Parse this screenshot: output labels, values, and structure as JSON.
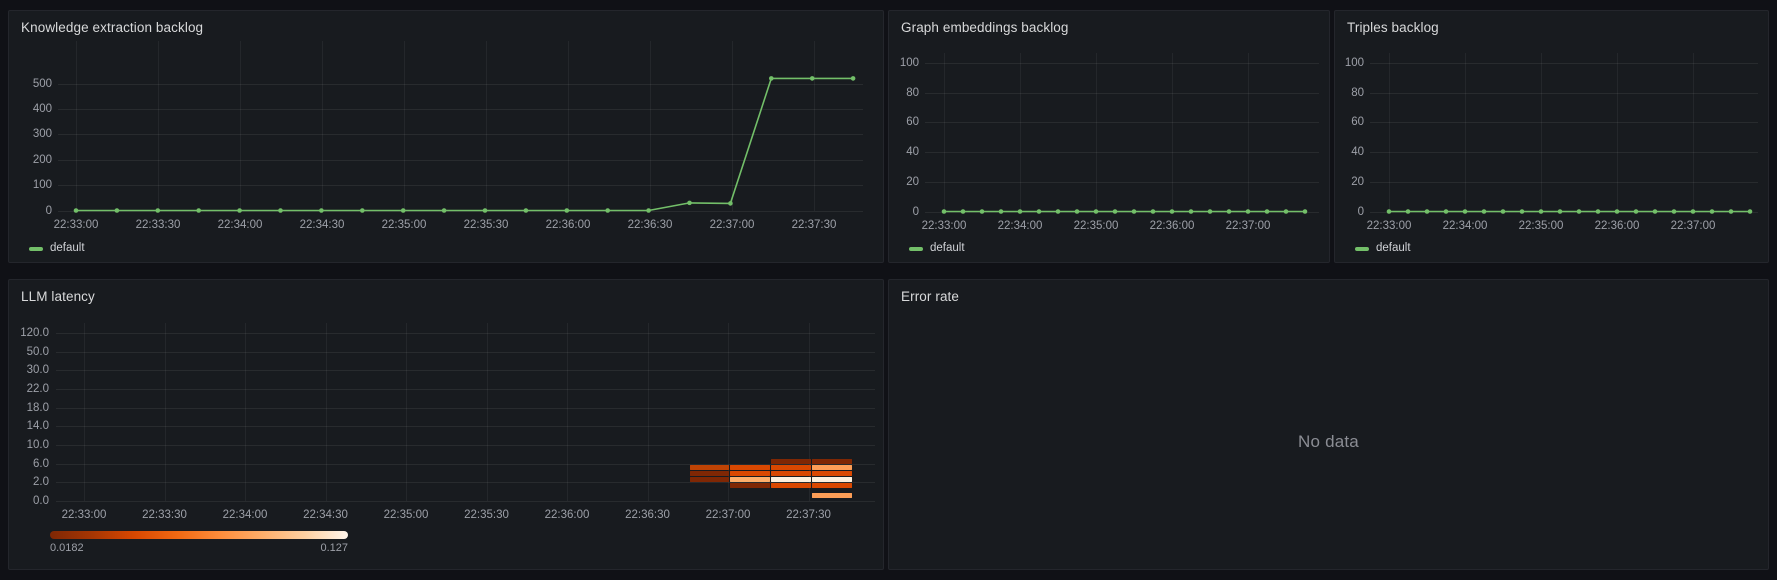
{
  "theme": {
    "page_bg": "#101116",
    "panel_bg": "#181b1f",
    "series_color": "#73bf69",
    "title_color": "#d8d9da",
    "tick_color": "#9da0a8"
  },
  "times_15s": [
    "22:33:00",
    "22:33:15",
    "22:33:30",
    "22:33:45",
    "22:34:00",
    "22:34:15",
    "22:34:30",
    "22:34:45",
    "22:35:00",
    "22:35:15",
    "22:35:30",
    "22:35:45",
    "22:36:00",
    "22:36:15",
    "22:36:30",
    "22:36:45",
    "22:37:00",
    "22:37:15",
    "22:37:30",
    "22:37:45"
  ],
  "panels": {
    "knowledge": {
      "title": "Knowledge extraction backlog",
      "legend": "default",
      "y_ticks": [
        "500",
        "400",
        "300",
        "200",
        "100",
        "0"
      ],
      "x_ticks": [
        "22:33:00",
        "22:33:30",
        "22:34:00",
        "22:34:30",
        "22:35:00",
        "22:35:30",
        "22:36:00",
        "22:36:30",
        "22:37:00",
        "22:37:30"
      ],
      "values": [
        0,
        0,
        0,
        0,
        0,
        0,
        0,
        0,
        0,
        0,
        0,
        0,
        0,
        0,
        0,
        30,
        28,
        520,
        520,
        520
      ]
    },
    "embeddings": {
      "title": "Graph embeddings backlog",
      "legend": "default",
      "y_ticks": [
        "100",
        "80",
        "60",
        "40",
        "20",
        "0"
      ],
      "x_ticks": [
        "22:33:00",
        "22:34:00",
        "22:35:00",
        "22:36:00",
        "22:37:00"
      ],
      "values": [
        0,
        0,
        0,
        0,
        0,
        0,
        0,
        0,
        0,
        0,
        0,
        0,
        0,
        0,
        0,
        0,
        0,
        0,
        0,
        0
      ]
    },
    "triples": {
      "title": "Triples backlog",
      "legend": "default",
      "y_ticks": [
        "100",
        "80",
        "60",
        "40",
        "20",
        "0"
      ],
      "x_ticks": [
        "22:33:00",
        "22:34:00",
        "22:35:00",
        "22:36:00",
        "22:37:00"
      ],
      "values": [
        0,
        0,
        0,
        0,
        0,
        0,
        0,
        0,
        0,
        0,
        0,
        0,
        0,
        0,
        0,
        0,
        0,
        0,
        0,
        0
      ]
    },
    "latency": {
      "title": "LLM latency",
      "y_ticks": [
        "120.0",
        "50.0",
        "30.0",
        "22.0",
        "18.0",
        "14.0",
        "10.0",
        "6.0",
        "2.0",
        "0.0"
      ],
      "x_ticks": [
        "22:33:00",
        "22:33:30",
        "22:34:00",
        "22:34:30",
        "22:35:00",
        "22:35:30",
        "22:36:00",
        "22:36:30",
        "22:37:00",
        "22:37:30"
      ],
      "colorbar": {
        "min_label": "0.0182",
        "max_label": "0.127",
        "colors": [
          "#7f2704",
          "#a63603",
          "#d94801",
          "#f16913",
          "#fd8d3c",
          "#fdae6b",
          "#fdd0a2",
          "#fff5eb"
        ]
      },
      "cells": [
        {
          "i": 15,
          "dy": 185,
          "color": "#bf4304",
          "time": "22:36:45"
        },
        {
          "i": 15,
          "dy": 191,
          "color": "#7f2704",
          "time": "22:36:45"
        },
        {
          "i": 15,
          "dy": 197,
          "color": "#7f2704",
          "time": "22:36:45"
        },
        {
          "i": 16,
          "dy": 185,
          "color": "#d94801",
          "time": "22:37:00"
        },
        {
          "i": 16,
          "dy": 191,
          "color": "#d94801",
          "time": "22:37:00"
        },
        {
          "i": 16,
          "dy": 197,
          "color": "#fdae6b",
          "time": "22:37:00"
        },
        {
          "i": 16,
          "dy": 203,
          "color": "#7f2704",
          "time": "22:37:00"
        },
        {
          "i": 17,
          "dy": 179,
          "color": "#7f2704",
          "time": "22:37:15"
        },
        {
          "i": 17,
          "dy": 185,
          "color": "#d94801",
          "time": "22:37:15"
        },
        {
          "i": 17,
          "dy": 191,
          "color": "#d94801",
          "time": "22:37:15"
        },
        {
          "i": 17,
          "dy": 197,
          "color": "#fdf0dd",
          "time": "22:37:15"
        },
        {
          "i": 17,
          "dy": 203,
          "color": "#d94801",
          "time": "22:37:15"
        },
        {
          "i": 18,
          "dy": 179,
          "color": "#7f2704",
          "time": "22:37:30"
        },
        {
          "i": 18,
          "dy": 185,
          "color": "#fd9e57",
          "time": "22:37:30"
        },
        {
          "i": 18,
          "dy": 191,
          "color": "#d94801",
          "time": "22:37:30"
        },
        {
          "i": 18,
          "dy": 197,
          "color": "#fdf0dd",
          "time": "22:37:30"
        },
        {
          "i": 18,
          "dy": 203,
          "color": "#d94801",
          "time": "22:37:30"
        },
        {
          "i": 18,
          "dy": 213,
          "color": "#fd9e57",
          "time": "22:37:30"
        }
      ]
    },
    "errorrate": {
      "title": "Error rate",
      "message": "No data"
    }
  },
  "chart_data": [
    {
      "type": "line",
      "title": "Knowledge extraction backlog",
      "legend": [
        "default"
      ],
      "x": [
        "22:33:00",
        "22:33:15",
        "22:33:30",
        "22:33:45",
        "22:34:00",
        "22:34:15",
        "22:34:30",
        "22:34:45",
        "22:35:00",
        "22:35:15",
        "22:35:30",
        "22:35:45",
        "22:36:00",
        "22:36:15",
        "22:36:30",
        "22:36:45",
        "22:37:00",
        "22:37:15",
        "22:37:30",
        "22:37:45"
      ],
      "series": [
        {
          "name": "default",
          "values": [
            0,
            0,
            0,
            0,
            0,
            0,
            0,
            0,
            0,
            0,
            0,
            0,
            0,
            0,
            0,
            30,
            28,
            520,
            520,
            520
          ]
        }
      ],
      "ylim": [
        0,
        560
      ],
      "grid": true,
      "line_color": "#73bf69",
      "legend_position": "bottom-left"
    },
    {
      "type": "line",
      "title": "Graph embeddings backlog",
      "legend": [
        "default"
      ],
      "x": [
        "22:33:00",
        "22:33:15",
        "22:33:30",
        "22:33:45",
        "22:34:00",
        "22:34:15",
        "22:34:30",
        "22:34:45",
        "22:35:00",
        "22:35:15",
        "22:35:30",
        "22:35:45",
        "22:36:00",
        "22:36:15",
        "22:36:30",
        "22:36:45",
        "22:37:00",
        "22:37:15",
        "22:37:30",
        "22:37:45"
      ],
      "series": [
        {
          "name": "default",
          "values": [
            0,
            0,
            0,
            0,
            0,
            0,
            0,
            0,
            0,
            0,
            0,
            0,
            0,
            0,
            0,
            0,
            0,
            0,
            0,
            0
          ]
        }
      ],
      "ylim": [
        0,
        100
      ],
      "grid": true,
      "line_color": "#73bf69",
      "legend_position": "bottom-left"
    },
    {
      "type": "line",
      "title": "Triples backlog",
      "legend": [
        "default"
      ],
      "x": [
        "22:33:00",
        "22:33:15",
        "22:33:30",
        "22:33:45",
        "22:34:00",
        "22:34:15",
        "22:34:30",
        "22:34:45",
        "22:35:00",
        "22:35:15",
        "22:35:30",
        "22:35:45",
        "22:36:00",
        "22:36:15",
        "22:36:30",
        "22:36:45",
        "22:37:00",
        "22:37:15",
        "22:37:30",
        "22:37:45"
      ],
      "series": [
        {
          "name": "default",
          "values": [
            0,
            0,
            0,
            0,
            0,
            0,
            0,
            0,
            0,
            0,
            0,
            0,
            0,
            0,
            0,
            0,
            0,
            0,
            0,
            0
          ]
        }
      ],
      "ylim": [
        0,
        100
      ],
      "grid": true,
      "line_color": "#73bf69",
      "legend_position": "bottom-left"
    },
    {
      "type": "heatmap",
      "title": "LLM latency",
      "y_buckets": [
        "0.0",
        "2.0",
        "6.0",
        "10.0",
        "14.0",
        "18.0",
        "22.0",
        "30.0",
        "50.0",
        "120.0"
      ],
      "x_range": [
        "22:33:00",
        "22:37:45"
      ],
      "occupied_columns": [
        "22:36:45",
        "22:37:00",
        "22:37:15",
        "22:37:30"
      ],
      "value_range": [
        0.0182,
        0.127
      ],
      "colorscale": "Oranges (dark-to-light = low-to-high)",
      "note": "cells cluster between y=0.5 and y=7 at the last four time buckets"
    },
    {
      "type": "line",
      "title": "Error rate",
      "series": [],
      "annotation": "No data"
    }
  ]
}
